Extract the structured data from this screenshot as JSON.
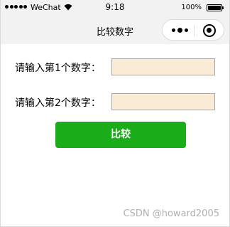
{
  "status_bar": {
    "carrier": "WeChat",
    "time": "9:18",
    "battery": "100%"
  },
  "nav": {
    "title": "比较数字"
  },
  "form": {
    "field1_label": "请输入第1个数字：",
    "field1_value": "",
    "field2_label": "请输入第2个数字：",
    "field2_value": "",
    "compare_label": "比较"
  },
  "colors": {
    "button": "#1aad19",
    "input_bg": "#faebd7"
  },
  "watermark": "CSDN @howard2005"
}
